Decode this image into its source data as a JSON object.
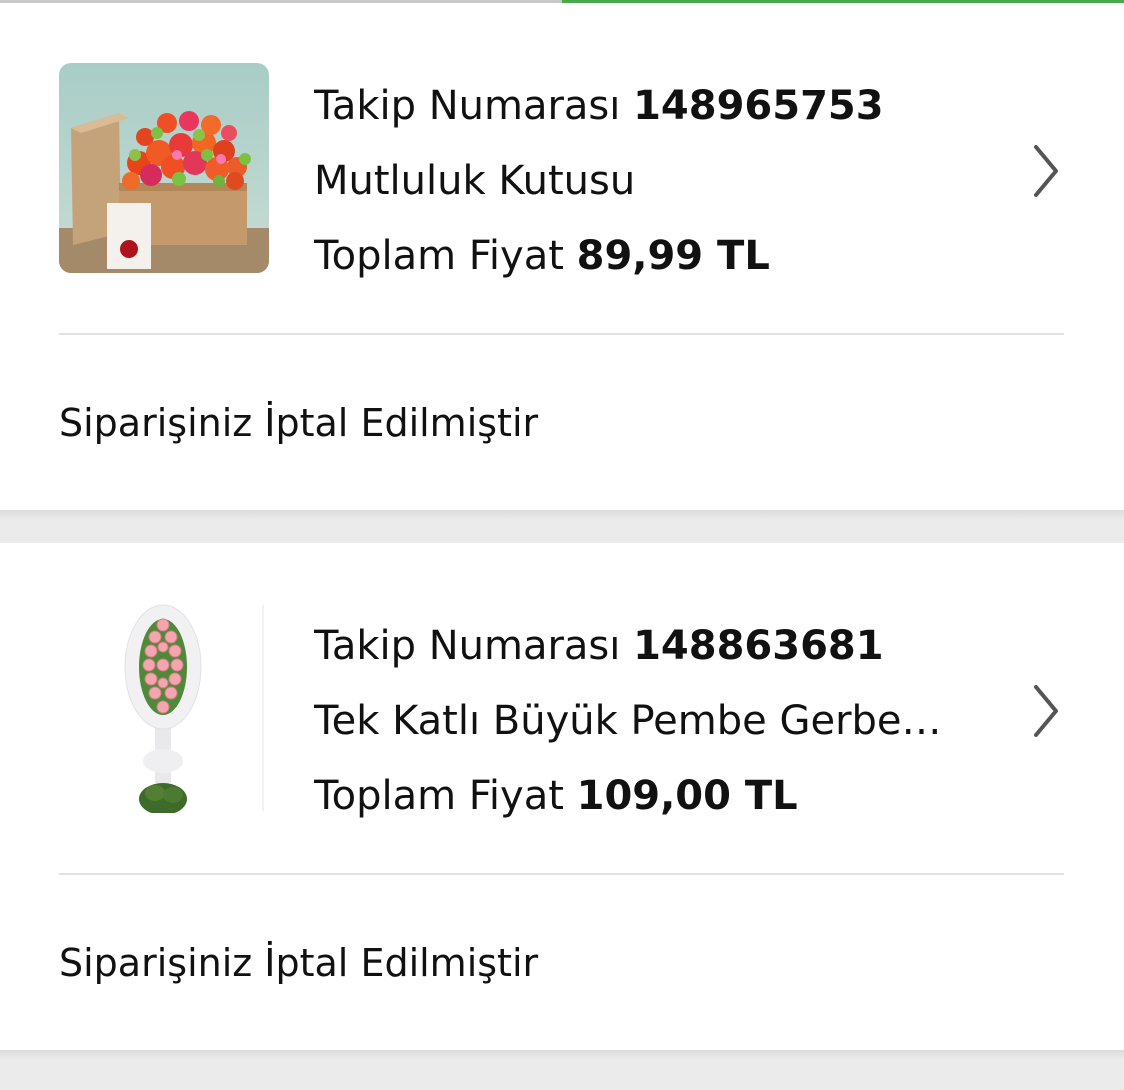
{
  "accent_color": "#4aa84a",
  "orders": [
    {
      "tracking_label": "Takip Numarası",
      "tracking_number": "148965753",
      "product_name": "Mutluluk Kutusu",
      "total_label": "Toplam Fiyat",
      "total_price": "89,99 TL",
      "status": "Siparişiniz İptal Edilmiştir",
      "thumbnail": "flower-box-image",
      "action_icon": "chevron-right-icon"
    },
    {
      "tracking_label": "Takip Numarası",
      "tracking_number": "148863681",
      "product_name": "Tek Katlı Büyük Pembe Gerber...",
      "total_label": "Toplam Fiyat",
      "total_price": "109,00 TL",
      "status": "Siparişiniz İptal Edilmiştir",
      "thumbnail": "funeral-wreath-image",
      "action_icon": "chevron-right-icon"
    }
  ]
}
